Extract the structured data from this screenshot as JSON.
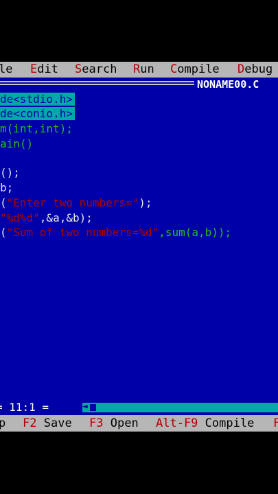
{
  "menubar": {
    "items": [
      {
        "hotkey": "",
        "rest": "le"
      },
      {
        "hotkey": "E",
        "rest": "dit"
      },
      {
        "hotkey": "S",
        "rest": "earch"
      },
      {
        "hotkey": "R",
        "rest": "un"
      },
      {
        "hotkey": "C",
        "rest": "ompile"
      },
      {
        "hotkey": "D",
        "rest": "ebug"
      }
    ]
  },
  "editor": {
    "file_title": "NONAME00.C",
    "code": {
      "l1": "de<stdio.h>",
      "l2": "de<conio.h>",
      "l3a": "m(int,int);",
      "l4": "ain()",
      "l6": "();",
      "l7": "b;",
      "l8a": "(",
      "l8b": "\"Enter two numbers=\"",
      "l8c": ");",
      "l9a": "\"%d%d\"",
      "l9b": ",&a,&b);",
      "l10a": "(",
      "l10b": "\"Sum of two numbers=%d\"",
      "l10c": ",sum(a,b));"
    }
  },
  "status": {
    "position": "= 11:1 ="
  },
  "fkeys": {
    "items": [
      {
        "key": "",
        "label": "p"
      },
      {
        "key": "F2",
        "label": "Save"
      },
      {
        "key": "F3",
        "label": "Open"
      },
      {
        "key": "Alt-F9",
        "label": "Compile"
      },
      {
        "key": "F",
        "label": ""
      }
    ]
  },
  "colors": {
    "editor_bg": "#0000a8",
    "menu_bg": "#b6b6b6",
    "hotkey": "#b00000",
    "string": "#b00000",
    "function": "#20c020",
    "include_highlight": "#00a8a8"
  }
}
